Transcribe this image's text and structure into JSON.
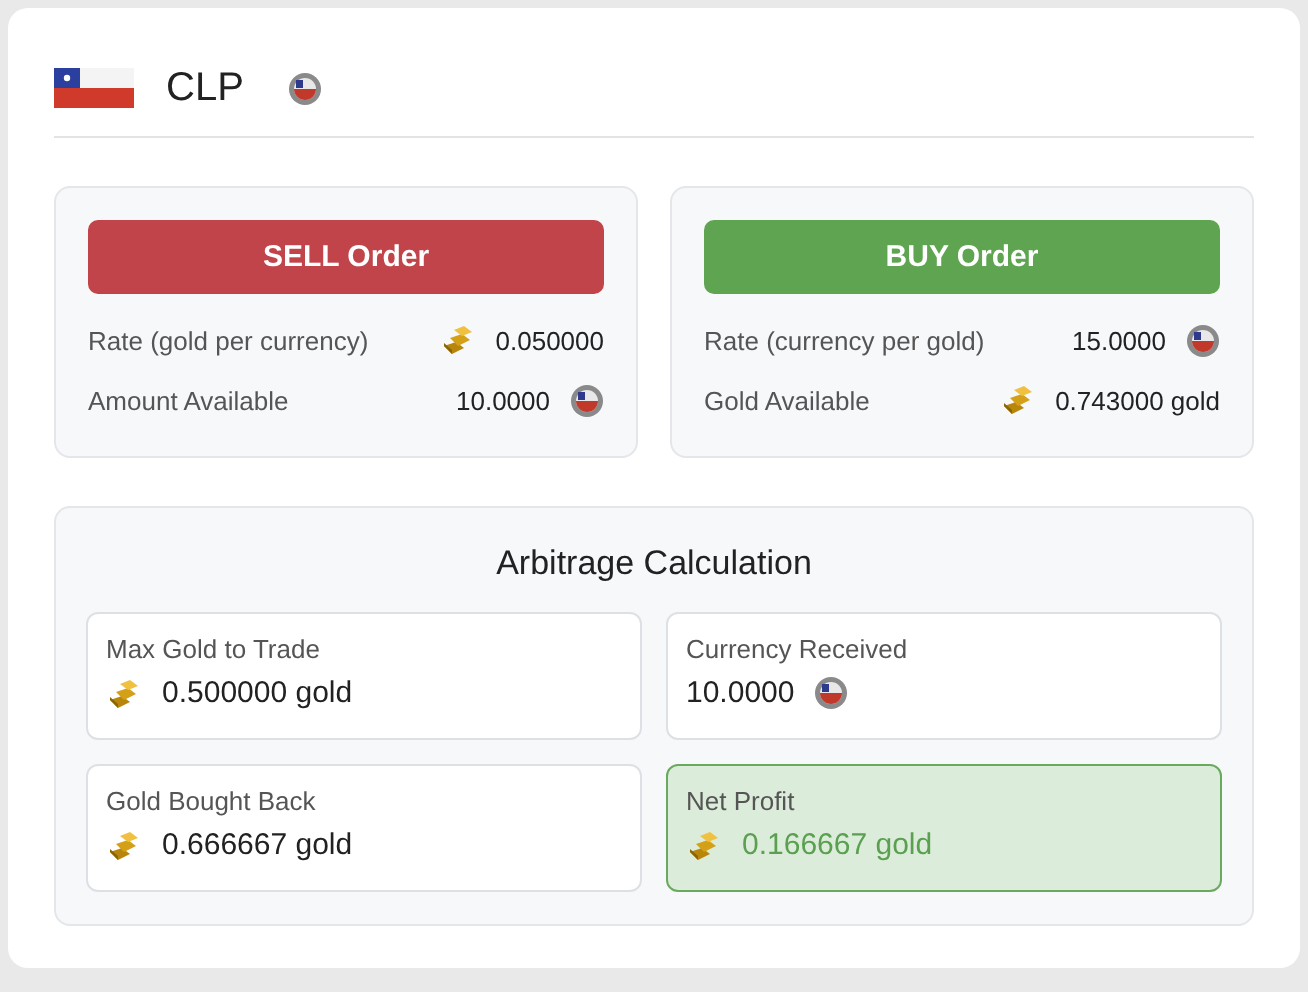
{
  "currency": {
    "code": "CLP"
  },
  "orders": [
    {
      "kind": "sell",
      "button": "SELL Order",
      "rows": [
        {
          "label": "Rate (gold per currency)",
          "value": "0.050000",
          "kind": "gold"
        },
        {
          "label": "Amount Available",
          "value": "10.0000",
          "kind": "currency"
        }
      ]
    },
    {
      "kind": "buy",
      "button": "BUY Order",
      "rows": [
        {
          "label": "Rate (currency per gold)",
          "value": "15.0000",
          "kind": "currency"
        },
        {
          "label": "Gold Available",
          "value": "0.743000 gold",
          "kind": "gold"
        }
      ]
    }
  ],
  "arbitrage": {
    "title": "Arbitrage Calculation",
    "cells": [
      {
        "label": "Max Gold to Trade",
        "value": "0.500000 gold",
        "kind": "gold",
        "highlight": false
      },
      {
        "label": "Currency Received",
        "value": "10.0000",
        "kind": "currency",
        "highlight": false
      },
      {
        "label": "Gold Bought Back",
        "value": "0.666667 gold",
        "kind": "gold",
        "highlight": false
      },
      {
        "label": "Net Profit",
        "value": "0.166667 gold",
        "kind": "gold",
        "highlight": true
      }
    ]
  }
}
